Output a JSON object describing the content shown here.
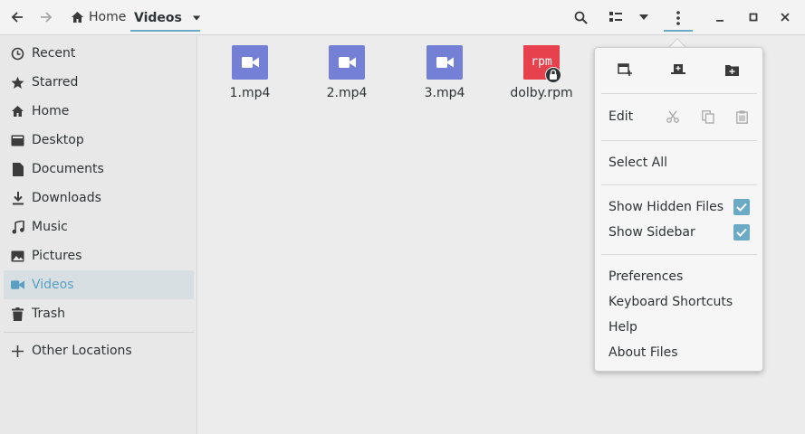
{
  "header": {
    "back_icon": "go-back-icon",
    "forward_icon": "go-forward-icon",
    "path": {
      "home_label": "Home",
      "current_label": "Videos"
    }
  },
  "sidebar": {
    "items": [
      {
        "label": "Recent",
        "icon": "clock-icon"
      },
      {
        "label": "Starred",
        "icon": "star-icon"
      },
      {
        "label": "Home",
        "icon": "home-icon"
      },
      {
        "label": "Desktop",
        "icon": "desktop-icon"
      },
      {
        "label": "Documents",
        "icon": "document-icon"
      },
      {
        "label": "Downloads",
        "icon": "download-icon"
      },
      {
        "label": "Music",
        "icon": "music-icon"
      },
      {
        "label": "Pictures",
        "icon": "picture-icon"
      },
      {
        "label": "Videos",
        "icon": "video-icon",
        "selected": true
      },
      {
        "label": "Trash",
        "icon": "trash-icon"
      }
    ],
    "other_locations": {
      "label": "Other Locations",
      "icon": "plus-icon"
    }
  },
  "files": [
    {
      "name": "1.mp4",
      "icon": "video-file-icon"
    },
    {
      "name": "2.mp4",
      "icon": "video-file-icon"
    },
    {
      "name": "3.mp4",
      "icon": "video-file-icon"
    },
    {
      "name": "dolby.rpm",
      "icon": "rpm-package-icon",
      "thumb_text": "rpm",
      "locked": true
    }
  ],
  "menu": {
    "edit_label": "Edit",
    "select_all": "Select All",
    "show_hidden_files": {
      "label": "Show Hidden Files",
      "checked": true
    },
    "show_sidebar": {
      "label": "Show Sidebar",
      "checked": true
    },
    "preferences": "Preferences",
    "keyboard_shortcuts": "Keyboard Shortcuts",
    "help": "Help",
    "about": "About Files"
  },
  "colors": {
    "accent": "#6aaac4",
    "video_icon": "#7480d6",
    "rpm_icon": "#e8414e"
  }
}
